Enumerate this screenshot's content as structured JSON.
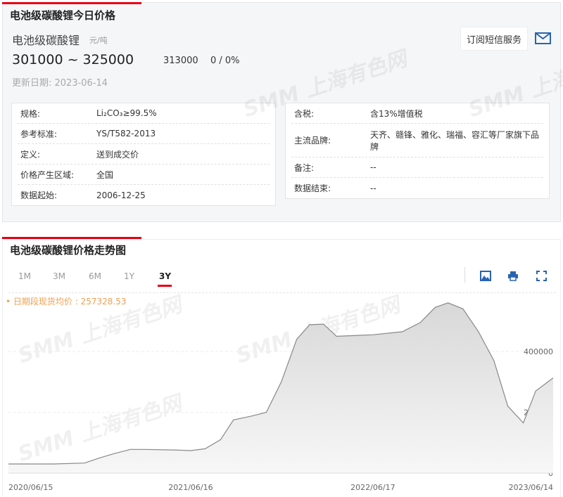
{
  "today": {
    "title": "电池级碳酸锂今日价格",
    "product": "电池级碳酸锂",
    "unit": "元/吨",
    "price_low": "301000",
    "sep": "~",
    "price_high": "325000",
    "avg": "313000",
    "change": "0 / 0%",
    "update": "更新日期: 2023-06-14",
    "subscribe": "订阅短信服务",
    "left": [
      {
        "k": "规格:",
        "v": "Li₂CO₃≥99.5%"
      },
      {
        "k": "参考标准:",
        "v": "YS/T582-2013"
      },
      {
        "k": "定义:",
        "v": "送到成交价"
      },
      {
        "k": "价格产生区域:",
        "v": "全国"
      },
      {
        "k": "数据起始:",
        "v": "2006-12-25"
      }
    ],
    "right": [
      {
        "k": "含税:",
        "v": "含13%增值税"
      },
      {
        "k": "主流品牌:",
        "v": "天齐、赣锋、雅化、瑞福、容汇等厂家旗下品牌"
      },
      {
        "k": "备注:",
        "v": "--"
      },
      {
        "k": "数据结束:",
        "v": "--"
      }
    ]
  },
  "trend": {
    "title": "电池级碳酸锂价格走势图",
    "tabs": [
      "1M",
      "3M",
      "6M",
      "1Y",
      "3Y"
    ],
    "active_tab": "3Y",
    "avg_label": "• 日期段现货均价 : 257328.53",
    "watermark": "SMM 上海有色网"
  },
  "chart_data": {
    "type": "area",
    "x_ticks": [
      "2020/06/15",
      "2021/06/16",
      "2022/06/17",
      "2023/06/14"
    ],
    "y_ticks": [
      0,
      200000,
      400000
    ],
    "ylim": [
      0,
      600000
    ],
    "grid": true,
    "points": [
      [
        "2020-06-15",
        30000
      ],
      [
        "2020-09-15",
        30000
      ],
      [
        "2020-11-15",
        33000
      ],
      [
        "2020-12-15",
        50000
      ],
      [
        "2021-01-15",
        65000
      ],
      [
        "2021-02-15",
        78000
      ],
      [
        "2021-03-15",
        78000
      ],
      [
        "2021-05-15",
        76000
      ],
      [
        "2021-06-16",
        74000
      ],
      [
        "2021-07-15",
        80000
      ],
      [
        "2021-08-15",
        110000
      ],
      [
        "2021-09-10",
        175000
      ],
      [
        "2021-10-15",
        187000
      ],
      [
        "2021-11-15",
        200000
      ],
      [
        "2021-12-15",
        300000
      ],
      [
        "2022-01-15",
        440000
      ],
      [
        "2022-02-10",
        488000
      ],
      [
        "2022-03-10",
        490000
      ],
      [
        "2022-04-05",
        450000
      ],
      [
        "2022-06-17",
        455000
      ],
      [
        "2022-08-15",
        465000
      ],
      [
        "2022-09-20",
        495000
      ],
      [
        "2022-10-20",
        545000
      ],
      [
        "2022-11-15",
        560000
      ],
      [
        "2022-12-15",
        540000
      ],
      [
        "2023-01-15",
        465000
      ],
      [
        "2023-02-15",
        370000
      ],
      [
        "2023-03-15",
        220000
      ],
      [
        "2023-04-15",
        165000
      ],
      [
        "2023-05-10",
        270000
      ],
      [
        "2023-06-14",
        313000
      ]
    ]
  }
}
